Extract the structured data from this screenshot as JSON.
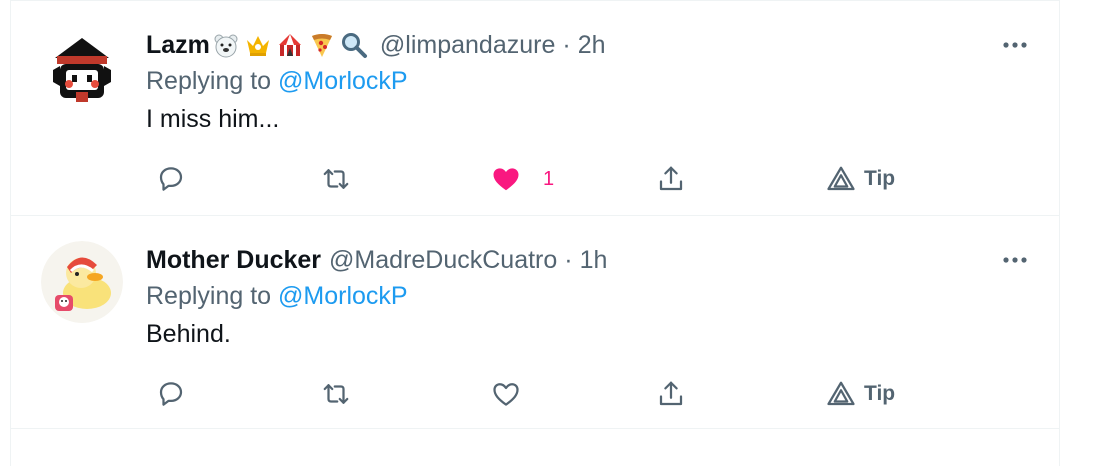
{
  "tweets": [
    {
      "name": "Lazm",
      "name_emojis": [
        "polar-bear-icon",
        "crown-icon",
        "circus-tent-icon",
        "pizza-icon",
        "magnifier-icon"
      ],
      "handle": "@limpandazure",
      "separator": "·",
      "time": "2h",
      "replying_prefix": "Replying to",
      "replying_to": "@MorlockP",
      "text": "I miss him...",
      "liked": true,
      "like_count": "1",
      "tip_label": "Tip"
    },
    {
      "name": "Mother Ducker",
      "handle": "@MadreDuckCuatro",
      "separator": "·",
      "time": "1h",
      "replying_prefix": "Replying to",
      "replying_to": "@MorlockP",
      "text": "Behind.",
      "liked": false,
      "like_count": "",
      "tip_label": "Tip"
    }
  ],
  "colors": {
    "text": "#0f1419",
    "secondary": "#536471",
    "link": "#1d9bf0",
    "like": "#f91880",
    "divider": "#eff3f4"
  }
}
